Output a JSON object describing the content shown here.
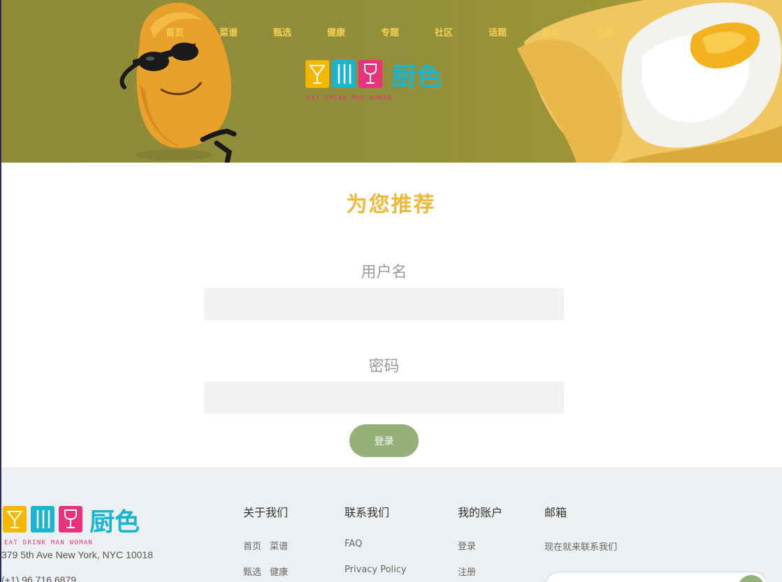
{
  "nav": {
    "items": [
      {
        "label": "首页"
      },
      {
        "label": "菜谱"
      },
      {
        "label": "甄选"
      },
      {
        "label": "健康"
      },
      {
        "label": "专题"
      },
      {
        "label": "社区"
      },
      {
        "label": "话题"
      },
      {
        "label": "登录"
      },
      {
        "label": "注册"
      }
    ]
  },
  "brand": {
    "name": "厨色",
    "tagline": "EAT DRINK MAN WOMAN"
  },
  "login": {
    "title": "为您推荐",
    "username_label": "用户名",
    "username_value": "",
    "password_label": "密码",
    "password_value": "",
    "submit_label": "登录"
  },
  "footer": {
    "address": "379 5th Ave New York, NYC 10018",
    "phone": "(+1) 96 716 6879",
    "about": {
      "heading": "关于我们",
      "links": [
        "首页",
        "菜谱",
        "甄选",
        "健康"
      ]
    },
    "contact": {
      "heading": "联系我们",
      "links": [
        "FAQ",
        "Privacy Policy"
      ]
    },
    "account": {
      "heading": "我的账户",
      "links": [
        "登录",
        "注册"
      ]
    },
    "mail": {
      "heading": "邮箱",
      "subtext": "现在就来联系我们",
      "value": ""
    }
  },
  "colors": {
    "nav_text": "#f3cf54",
    "title": "#f0b83a",
    "button": "#96b07a",
    "logo_yellow": "#f5b800",
    "logo_cyan": "#1ab5cf",
    "logo_pink": "#e8327c"
  }
}
